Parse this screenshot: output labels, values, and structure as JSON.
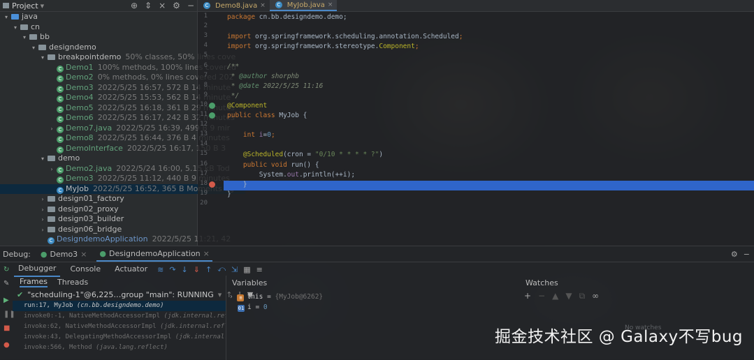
{
  "project": {
    "title": "Project",
    "tree": [
      {
        "label": "java",
        "meta": "",
        "indent": 0,
        "arrow": "▾",
        "type": "folder-blue"
      },
      {
        "label": "cn",
        "meta": "",
        "indent": 1,
        "arrow": "▾",
        "type": "folder"
      },
      {
        "label": "bb",
        "meta": "",
        "indent": 2,
        "arrow": "▾",
        "type": "folder"
      },
      {
        "label": "designdemo",
        "meta": "",
        "indent": 3,
        "arrow": "▾",
        "type": "folder"
      },
      {
        "label": "breakpointdemo",
        "meta": "50% classes, 50% lines cove",
        "indent": 4,
        "arrow": "▾",
        "type": "folder"
      },
      {
        "label": "Demo1",
        "meta": "100% methods, 100% lines covered",
        "indent": 5,
        "arrow": "",
        "type": "class-green"
      },
      {
        "label": "Demo2",
        "meta": "0% methods, 0% lines covered  202",
        "indent": 5,
        "arrow": "",
        "type": "class-green"
      },
      {
        "label": "Demo3",
        "meta": "2022/5/25 16:57, 572 B 14 minute",
        "indent": 5,
        "arrow": "",
        "type": "class-green"
      },
      {
        "label": "Demo4",
        "meta": "2022/5/25 15:53, 562 B 14 minute",
        "indent": 5,
        "arrow": "",
        "type": "class-green"
      },
      {
        "label": "Demo5",
        "meta": "2022/5/25 16:18, 361 B 29 minutes",
        "indent": 5,
        "arrow": "",
        "type": "class-green"
      },
      {
        "label": "Demo6",
        "meta": "2022/5/25 16:17, 242 B 32 minutes",
        "indent": 5,
        "arrow": "",
        "type": "class-green"
      },
      {
        "label": "Demo7.java",
        "meta": "2022/5/25 16:39, 499 B 9 mir",
        "indent": 5,
        "arrow": "›",
        "type": "class-green"
      },
      {
        "label": "Demo8",
        "meta": "2022/5/25 16:44, 376 B 4 minutes",
        "indent": 5,
        "arrow": "",
        "type": "class-green"
      },
      {
        "label": "DemoInterface",
        "meta": "2022/5/25 16:17, 150 B 3",
        "indent": 5,
        "arrow": "",
        "type": "class-green"
      },
      {
        "label": "demo",
        "meta": "",
        "indent": 4,
        "arrow": "▾",
        "type": "folder"
      },
      {
        "label": "Demo2.java",
        "meta": "2022/5/24 16:00, 5.15 kB Tod",
        "indent": 5,
        "arrow": "›",
        "type": "class-green"
      },
      {
        "label": "Demo3",
        "meta": "2022/5/25 11:12, 440 B 9 minutes",
        "indent": 5,
        "arrow": "",
        "type": "class-green"
      },
      {
        "label": "MyJob",
        "meta": "2022/5/25 16:52, 365 B Moments ag",
        "indent": 5,
        "arrow": "",
        "type": "class",
        "selected": true
      },
      {
        "label": "design01_factory",
        "meta": "",
        "indent": 4,
        "arrow": "›",
        "type": "folder"
      },
      {
        "label": "design02_proxy",
        "meta": "",
        "indent": 4,
        "arrow": "›",
        "type": "folder"
      },
      {
        "label": "design03_builder",
        "meta": "",
        "indent": 4,
        "arrow": "›",
        "type": "folder"
      },
      {
        "label": "design06_bridge",
        "meta": "",
        "indent": 4,
        "arrow": "›",
        "type": "folder"
      },
      {
        "label": "DesigndemoApplication",
        "meta": "2022/5/25 11:21, 42",
        "indent": 4,
        "arrow": "",
        "type": "class-blue"
      }
    ]
  },
  "editor": {
    "tabs": [
      {
        "label": "Demo8.java",
        "active": false
      },
      {
        "label": "MyJob.java",
        "active": true
      }
    ],
    "line_numbers": [
      "1",
      "2",
      "3",
      "4",
      "5",
      "6",
      "7",
      "8",
      "9",
      "10",
      "11",
      "12",
      "13",
      "14",
      "15",
      "16",
      "17",
      "18",
      "19",
      "20"
    ],
    "lines": [
      [
        {
          "t": "package ",
          "c": "kw"
        },
        {
          "t": "cn.bb.designdemo.demo;",
          "c": ""
        }
      ],
      [],
      [
        {
          "t": "import ",
          "c": "kw"
        },
        {
          "t": "org.springframework.scheduling.annotation.Scheduled",
          "c": ""
        },
        {
          "t": ";",
          "c": "kw"
        }
      ],
      [
        {
          "t": "import ",
          "c": "kw"
        },
        {
          "t": "org.springframework.stereotype.",
          "c": ""
        },
        {
          "t": "Component",
          "c": "ann"
        },
        {
          "t": ";",
          "c": "kw"
        }
      ],
      [],
      [
        {
          "t": "/**",
          "c": "cmt"
        }
      ],
      [
        {
          "t": " * ",
          "c": "cmt"
        },
        {
          "t": "@author",
          "c": "doc"
        },
        {
          "t": " shorphb",
          "c": "cmt"
        }
      ],
      [
        {
          "t": " * ",
          "c": "cmt"
        },
        {
          "t": "@date",
          "c": "doc"
        },
        {
          "t": " 2022/5/25 11:16",
          "c": "cmt"
        }
      ],
      [
        {
          "t": " */",
          "c": "cmt"
        }
      ],
      [
        {
          "t": "@Component",
          "c": "ann"
        }
      ],
      [
        {
          "t": "public class ",
          "c": "kw"
        },
        {
          "t": "MyJob {",
          "c": ""
        }
      ],
      [],
      [
        {
          "t": "    int ",
          "c": "kw"
        },
        {
          "t": "i",
          "c": "fld"
        },
        {
          "t": "=",
          "c": ""
        },
        {
          "t": "0",
          "c": "num"
        },
        {
          "t": ";",
          "c": "kw"
        }
      ],
      [],
      [
        {
          "t": "    @Scheduled",
          "c": "ann"
        },
        {
          "t": "(cron = ",
          "c": ""
        },
        {
          "t": "\"0/10 * * * * ?\"",
          "c": "str"
        },
        {
          "t": ")",
          "c": ""
        }
      ],
      [
        {
          "t": "    public void ",
          "c": "kw"
        },
        {
          "t": "run() {",
          "c": ""
        }
      ],
      [
        {
          "t": "        System.",
          "c": ""
        },
        {
          "t": "out",
          "c": "fld"
        },
        {
          "t": ".println(++i);",
          "c": ""
        }
      ],
      [
        {
          "t": "    }",
          "c": ""
        }
      ],
      [
        {
          "t": "}",
          "c": ""
        }
      ],
      []
    ]
  },
  "debug": {
    "label": "Debug:",
    "tabs": [
      {
        "label": "Demo3",
        "active": false
      },
      {
        "label": "DesigndemoApplication",
        "active": true
      }
    ],
    "toolbar_tabs": [
      "Debugger",
      "Console",
      "Actuator"
    ],
    "frames_tab": "Frames",
    "threads_tab": "Threads",
    "thread": "\"scheduling-1\"@6,225…group \"main\": RUNNING",
    "frames": [
      {
        "method": "run:17, MyJob",
        "pkg": "(cn.bb.designdemo.demo)",
        "current": true
      },
      {
        "method": "invoke0:-1, NativeMethodAccessorImpl",
        "pkg": "(jdk.internal.reflect)",
        "current": false
      },
      {
        "method": "invoke:62, NativeMethodAccessorImpl",
        "pkg": "(jdk.internal.reflect)",
        "current": false
      },
      {
        "method": "invoke:43, DelegatingMethodAccessorImpl",
        "pkg": "(jdk.internal.reflect)",
        "current": false
      },
      {
        "method": "invoke:566, Method",
        "pkg": "(java.lang.reflect)",
        "current": false
      }
    ],
    "variables_title": "Variables",
    "variables": [
      {
        "name": "this",
        "eq": " = ",
        "value": "{MyJob@6262}",
        "badge": "≡"
      },
      {
        "name": "i",
        "eq": " = ",
        "value": "0",
        "badge": "01"
      }
    ],
    "watches_title": "Watches",
    "no_watches": "No watches"
  },
  "watermark": "掘金技术社区 @ Galaxy不写bug",
  "colors": {
    "selection": "#2f65ca",
    "accent": "#4a88c7",
    "watermark": "#f2f2f2"
  }
}
